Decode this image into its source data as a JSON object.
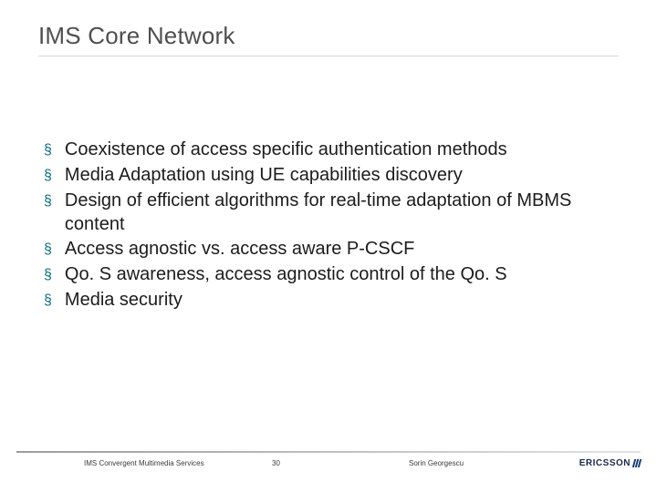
{
  "title": "IMS Core Network",
  "bullets": [
    "Coexistence of access specific authentication methods",
    "Media Adaptation using UE capabilities discovery",
    "Design of efficient algorithms for real-time adaptation of MBMS content",
    "Access agnostic vs. access aware P-CSCF",
    "Qo. S awareness, access agnostic control of the Qo. S",
    "Media security"
  ],
  "footer": {
    "left": "IMS Convergent Multimedia Services",
    "center": "30",
    "right": "Sorin Georgescu",
    "logo": "ERICSSON"
  }
}
